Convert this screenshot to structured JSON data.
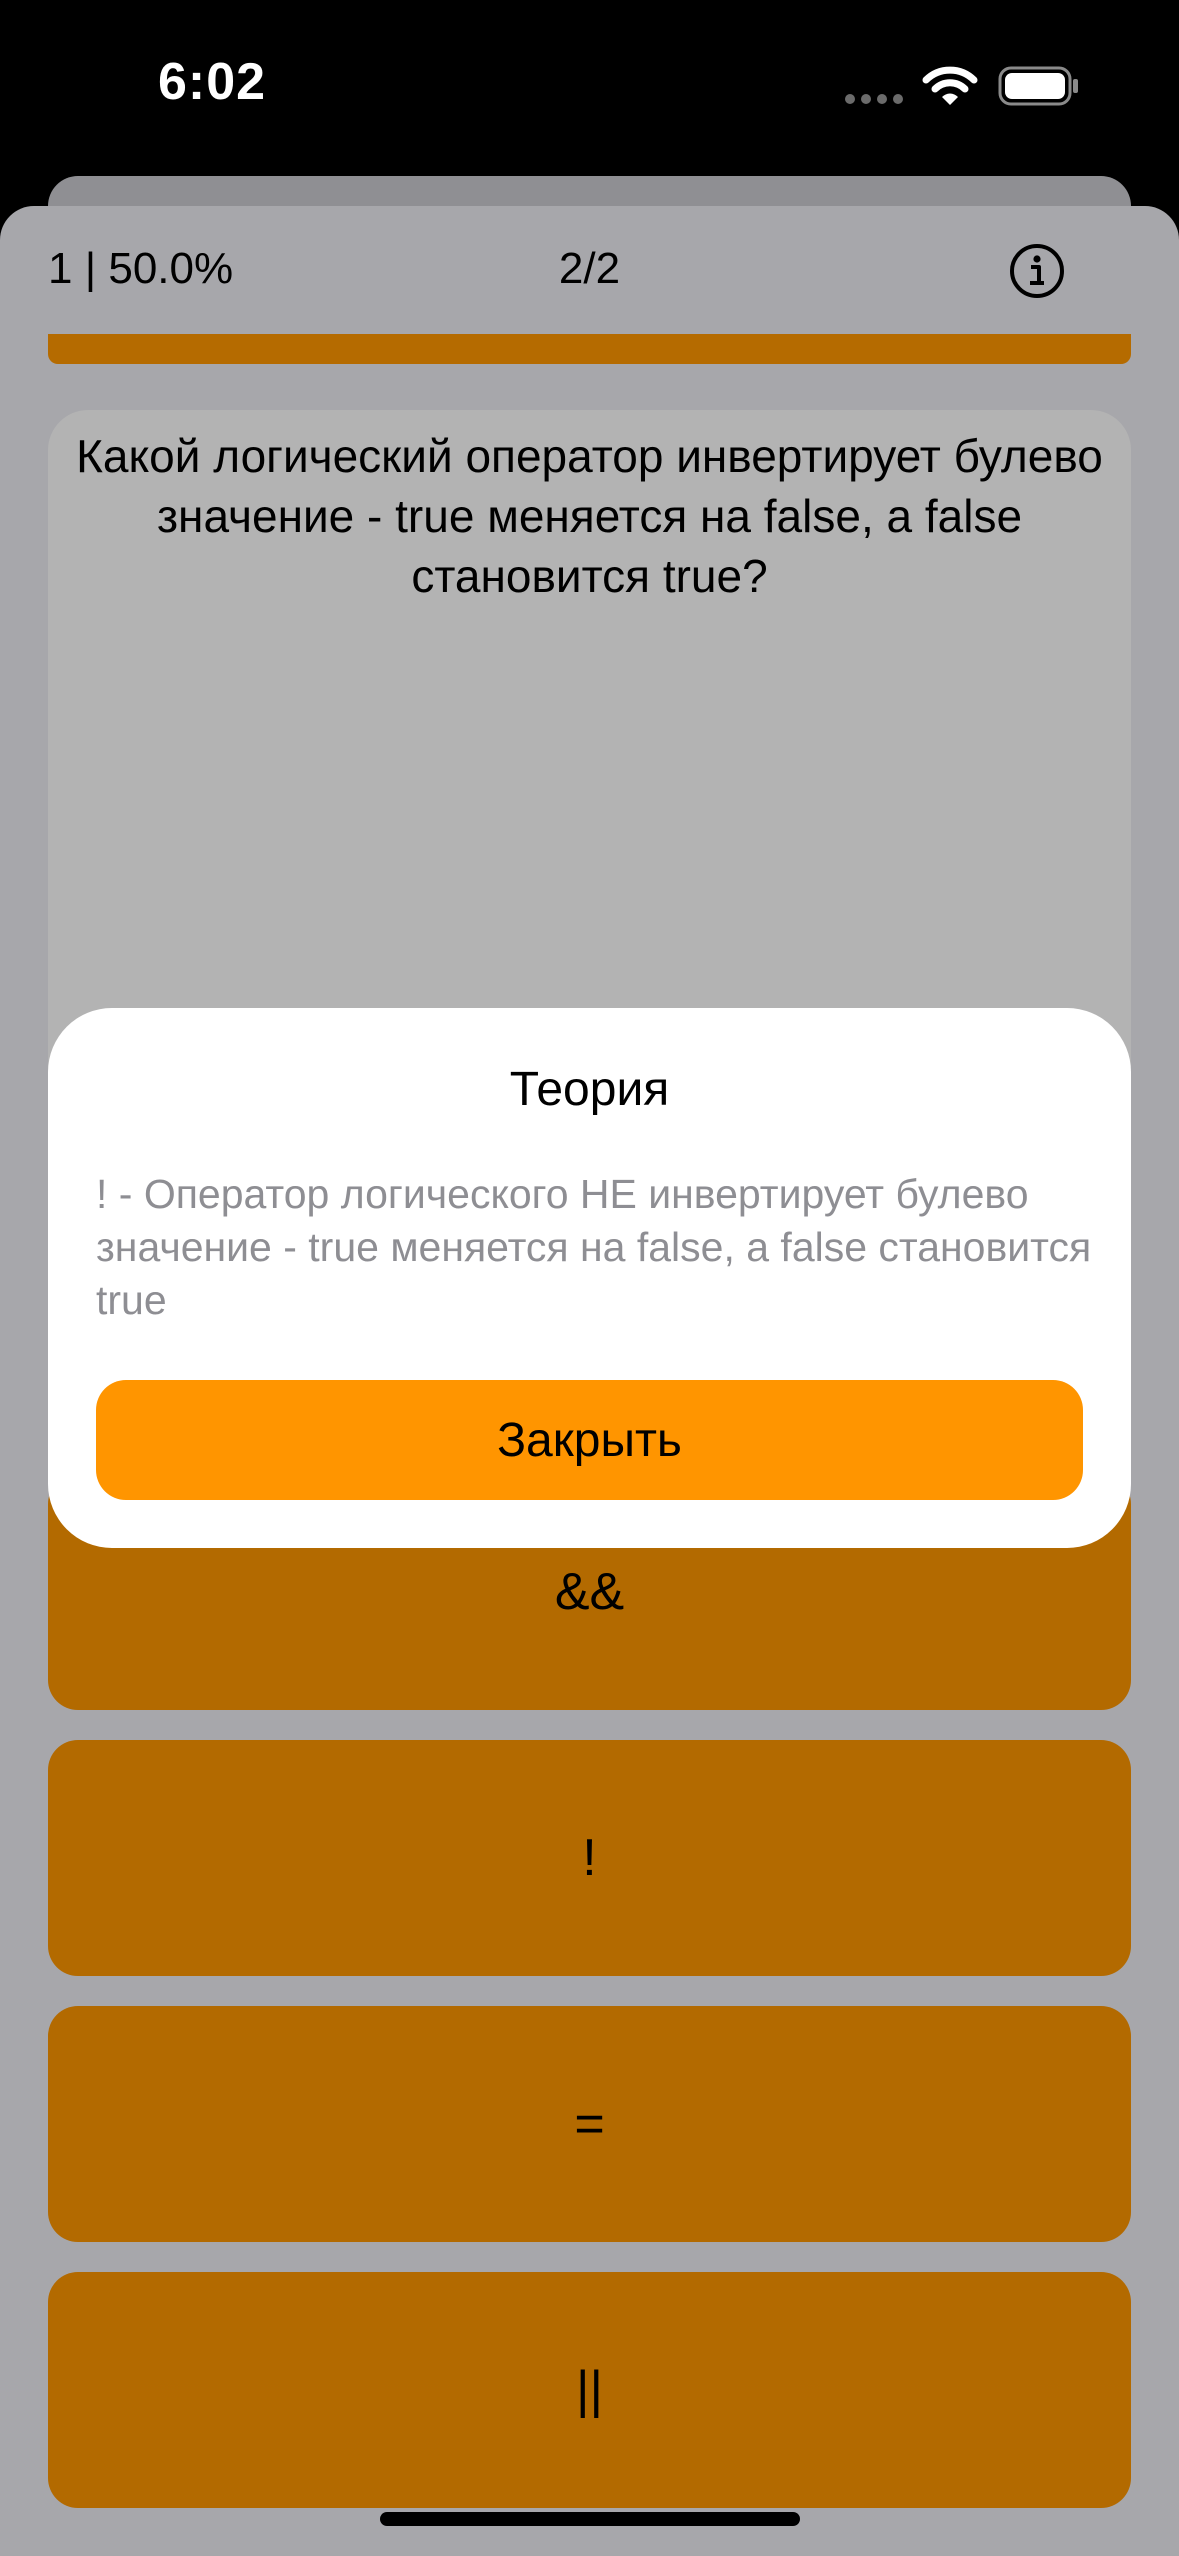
{
  "status_bar": {
    "time": "6:02",
    "icons": [
      "signal-dots-icon",
      "wifi-icon",
      "battery-icon"
    ]
  },
  "header": {
    "score": "1 | 50.0%",
    "counter": "2/2",
    "info_icon": "info-icon"
  },
  "progress": {
    "fraction": 1.0
  },
  "question": {
    "text": "Какой логический оператор инвертирует булево значение - true меняется на false, а false становится true?"
  },
  "answers": [
    {
      "label": "&&"
    },
    {
      "label": "!"
    },
    {
      "label": "="
    },
    {
      "label": "||"
    }
  ],
  "modal": {
    "title": "Теория",
    "body": "! - Оператор логического НЕ инвертирует булево значение - true меняется на false, а false становится true",
    "close_label": "Закрыть"
  },
  "colors": {
    "accent": "#ff9500",
    "answer_bg": "#b36a00",
    "sheet_bg": "#a7a7ab",
    "card_bg": "#b3b3b3"
  }
}
